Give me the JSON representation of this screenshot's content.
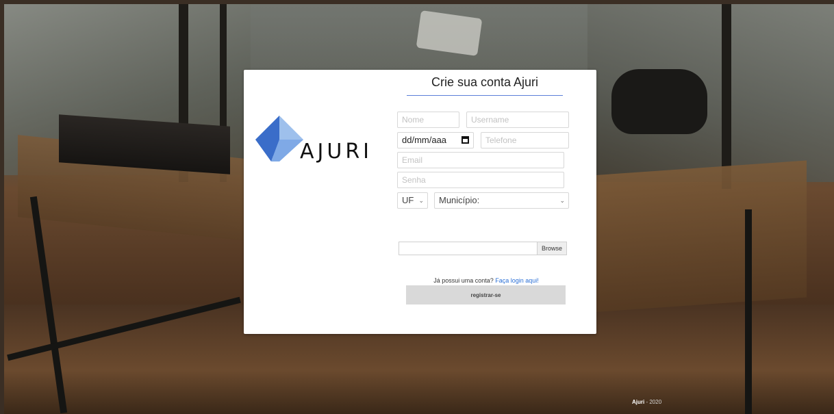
{
  "brand": {
    "logo_text": "AJURI",
    "colors": {
      "dark_blue": "#3a6dc9",
      "light_blue": "#9ec0ec"
    }
  },
  "form": {
    "title": "Crie sua conta Ajuri",
    "nome_placeholder": "Nome",
    "username_placeholder": "Username",
    "date_value": "dd/mm/aaa",
    "date_icon": "calendar-icon",
    "telefone_placeholder": "Telefone",
    "email_placeholder": "Email",
    "senha_placeholder": "Senha",
    "uf_label": "UF",
    "municipio_label": "Município:",
    "browse_label": "Browse",
    "login_prompt": "Já possui uma conta?",
    "login_link": "Faça login aqui!",
    "register_label": "registrar-se"
  },
  "footer": {
    "brand": "Ajuri",
    "year_suffix": " - 2020"
  },
  "colors": {
    "accent_line": "#5b7fd8",
    "link": "#2a6fd6",
    "button_bg": "#d9d9d9"
  }
}
